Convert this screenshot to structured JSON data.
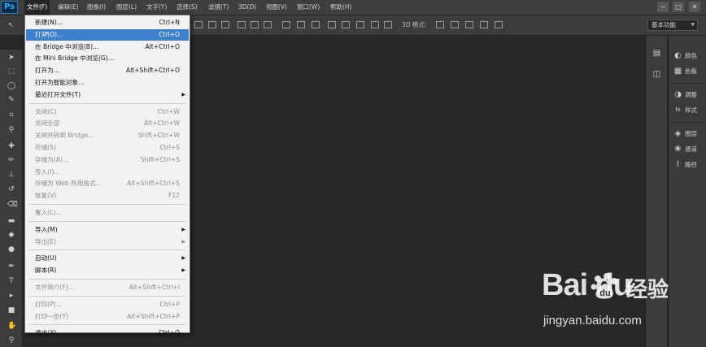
{
  "app": {
    "logo": "Ps"
  },
  "menubar": {
    "items": [
      "文件(F)",
      "编辑(E)",
      "图像(I)",
      "图层(L)",
      "文字(Y)",
      "选择(S)",
      "滤镜(T)",
      "3D(D)",
      "视图(V)",
      "窗口(W)",
      "帮助(H)"
    ],
    "window_controls": [
      "−",
      "□",
      "✕"
    ]
  },
  "optionsbar": {
    "mode_3d_label": "3D 模式:",
    "workspace": "基本功能"
  },
  "file_menu": {
    "items": [
      {
        "label": "新建(N)...",
        "shortcut": "Ctrl+N",
        "enabled": true
      },
      {
        "label": "打开(O)...",
        "shortcut": "Ctrl+O",
        "enabled": true,
        "highlighted": true
      },
      {
        "label": "在 Bridge 中浏览(B)...",
        "shortcut": "Alt+Ctrl+O",
        "enabled": true
      },
      {
        "label": "在 Mini Bridge 中浏览(G)...",
        "shortcut": "",
        "enabled": true
      },
      {
        "label": "打开为...",
        "shortcut": "Alt+Shift+Ctrl+O",
        "enabled": true
      },
      {
        "label": "打开为智能对象...",
        "shortcut": "",
        "enabled": true
      },
      {
        "label": "最近打开文件(T)",
        "shortcut": "",
        "enabled": true,
        "submenu": true
      },
      {
        "separator": true
      },
      {
        "label": "关闭(C)",
        "shortcut": "Ctrl+W",
        "enabled": false
      },
      {
        "label": "关闭全部",
        "shortcut": "Alt+Ctrl+W",
        "enabled": false
      },
      {
        "label": "关闭并转到 Bridge...",
        "shortcut": "Shift+Ctrl+W",
        "enabled": false
      },
      {
        "label": "存储(S)",
        "shortcut": "Ctrl+S",
        "enabled": false
      },
      {
        "label": "存储为(A)...",
        "shortcut": "Shift+Ctrl+S",
        "enabled": false
      },
      {
        "label": "签入(I)...",
        "shortcut": "",
        "enabled": false
      },
      {
        "label": "存储为 Web 所用格式...",
        "shortcut": "Alt+Shift+Ctrl+S",
        "enabled": false
      },
      {
        "label": "恢复(V)",
        "shortcut": "F12",
        "enabled": false
      },
      {
        "separator": true
      },
      {
        "label": "置入(L)...",
        "shortcut": "",
        "enabled": false
      },
      {
        "separator": true
      },
      {
        "label": "导入(M)",
        "shortcut": "",
        "enabled": true,
        "submenu": true
      },
      {
        "label": "导出(E)",
        "shortcut": "",
        "enabled": false,
        "submenu": true
      },
      {
        "separator": true
      },
      {
        "label": "自动(U)",
        "shortcut": "",
        "enabled": true,
        "submenu": true
      },
      {
        "label": "脚本(R)",
        "shortcut": "",
        "enabled": true,
        "submenu": true
      },
      {
        "separator": true
      },
      {
        "label": "文件简介(F)...",
        "shortcut": "Alt+Shift+Ctrl+I",
        "enabled": false
      },
      {
        "separator": true
      },
      {
        "label": "打印(P)...",
        "shortcut": "Ctrl+P",
        "enabled": false
      },
      {
        "label": "打印一份(Y)",
        "shortcut": "Alt+Shift+Ctrl+P",
        "enabled": false
      },
      {
        "separator": true
      },
      {
        "label": "退出(X)",
        "shortcut": "Ctrl+Q",
        "enabled": true
      }
    ]
  },
  "right_panels": {
    "groups": [
      [
        {
          "label": "颜色",
          "icon": "color-palette-icon"
        },
        {
          "label": "色板",
          "icon": "swatches-grid-icon"
        }
      ],
      [
        {
          "label": "调整",
          "icon": "adjustments-circle-icon"
        },
        {
          "label": "样式",
          "icon": "styles-fx-icon"
        }
      ],
      [
        {
          "label": "图层",
          "icon": "layers-stack-icon"
        },
        {
          "label": "通道",
          "icon": "channels-rgb-icon"
        },
        {
          "label": "路径",
          "icon": "paths-pen-icon"
        }
      ]
    ]
  },
  "tools": [
    "move-tool-icon",
    "marquee-tool-icon",
    "lasso-tool-icon",
    "quick-select-tool-icon",
    "crop-tool-icon",
    "eyedropper-tool-icon",
    "healing-brush-tool-icon",
    "brush-tool-icon",
    "clone-stamp-tool-icon",
    "history-brush-tool-icon",
    "eraser-tool-icon",
    "gradient-tool-icon",
    "blur-tool-icon",
    "dodge-tool-icon",
    "pen-tool-icon",
    "type-tool-icon",
    "path-select-tool-icon",
    "shape-tool-icon",
    "hand-tool-icon",
    "zoom-tool-icon"
  ],
  "watermark": {
    "logo": "Bai  du",
    "name": "经验",
    "url": "jingyan.baidu.com"
  }
}
